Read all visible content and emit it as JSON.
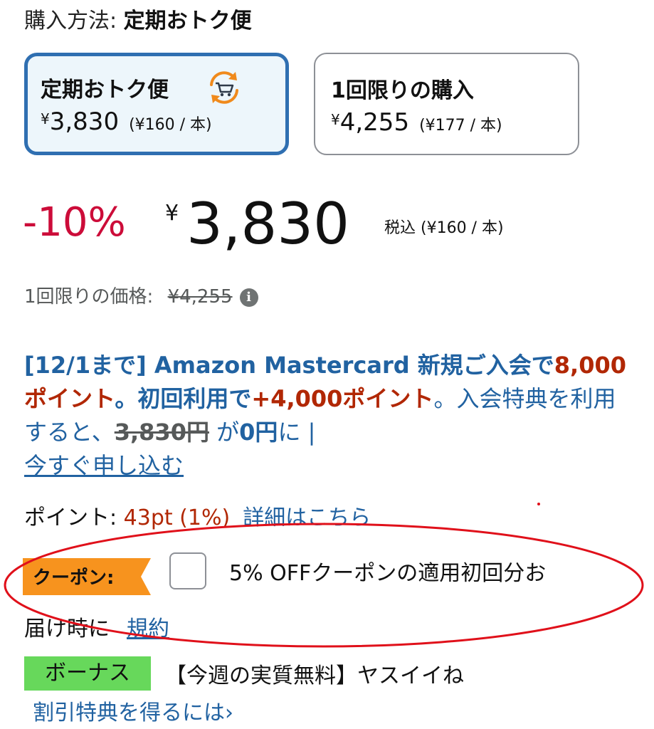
{
  "purchase_method": {
    "label": "購入方法: ",
    "value": "定期おトク便"
  },
  "options": {
    "subscription": {
      "title": "定期おトク便",
      "yen": "¥",
      "price": "3,830",
      "unit_price": "(¥160 / 本)",
      "icon": "subscribe-cart-icon",
      "selected": true
    },
    "one_time": {
      "title": "1回限りの購入",
      "yen": "¥",
      "price": "4,255",
      "unit_price": "(¥177 / 本)",
      "selected": false
    }
  },
  "price_block": {
    "discount": "-10%",
    "yen": "¥",
    "price": "3,830",
    "tax_note": "税込 (¥160 / 本)"
  },
  "one_time_price": {
    "label": "1回限りの価格: ",
    "price": "¥4,255",
    "icon": "info-icon"
  },
  "promo": {
    "part1": "[12/1まで] Amazon Mastercard 新規ご入会で",
    "points1": "8,000ポイント",
    "part2": "。初回利用で",
    "points2": "+4,000ポイント",
    "part3": "。入会特典を利用すると、",
    "old_price": "3,830円",
    "part4": " が",
    "new_price": "0円",
    "part5": "に | ",
    "apply_link": "今すぐ申し込む"
  },
  "points": {
    "label": "ポイント: ",
    "value": "43pt  (1%)",
    "detail_link": "詳細はこちら"
  },
  "coupon": {
    "badge": "クーポン:",
    "text_line1": "5% OFFクーポンの適用初回分お",
    "text_line2": "届け時に",
    "terms_link": "規約",
    "checked": false
  },
  "bonus": {
    "badge": "ボーナス",
    "text": "【今週の実質無料】ヤスイイね",
    "link": "割引特典を得るには›"
  },
  "colors": {
    "accent_blue": "#2f6fb1",
    "link_blue": "#2162a1",
    "discount_red": "#cc0c39",
    "price_red": "#b12704",
    "coupon_orange": "#f7931e",
    "bonus_green": "#67d85b",
    "annotation_red": "#e0101a"
  }
}
